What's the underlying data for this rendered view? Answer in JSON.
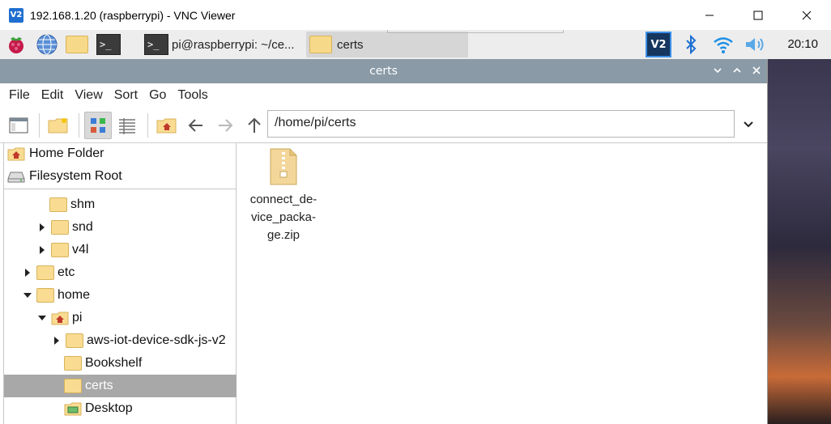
{
  "vnc": {
    "title": "192.168.1.20 (raspberrypi) - VNC Viewer",
    "logo_text": "V2"
  },
  "panel": {
    "tasks": [
      {
        "label": "pi@raspberrypi: ~/ce..."
      },
      {
        "label": "certs"
      }
    ],
    "clock": "20:10"
  },
  "fm": {
    "title": "certs",
    "menus": [
      "File",
      "Edit",
      "View",
      "Sort",
      "Go",
      "Tools"
    ],
    "address": "/home/pi/certs",
    "places": [
      {
        "label": "Home Folder",
        "icon": "home-folder-icon"
      },
      {
        "label": "Filesystem Root",
        "icon": "drive-icon"
      }
    ],
    "tree": [
      {
        "label": "shm"
      },
      {
        "label": "snd"
      },
      {
        "label": "v4l"
      },
      {
        "label": "etc"
      },
      {
        "label": "home"
      },
      {
        "label": "pi"
      },
      {
        "label": "aws-iot-device-sdk-js-v2"
      },
      {
        "label": "Bookshelf"
      },
      {
        "label": "certs"
      },
      {
        "label": "Desktop"
      }
    ],
    "files": [
      {
        "name_lines": [
          "connect_de-",
          "vice_packa-",
          "ge.zip"
        ],
        "icon": "zip-archive-icon"
      }
    ]
  },
  "colors": {
    "titlebar": "#8a9aa6",
    "selection": "#a8a8a8",
    "folder": "#f9dc92"
  }
}
